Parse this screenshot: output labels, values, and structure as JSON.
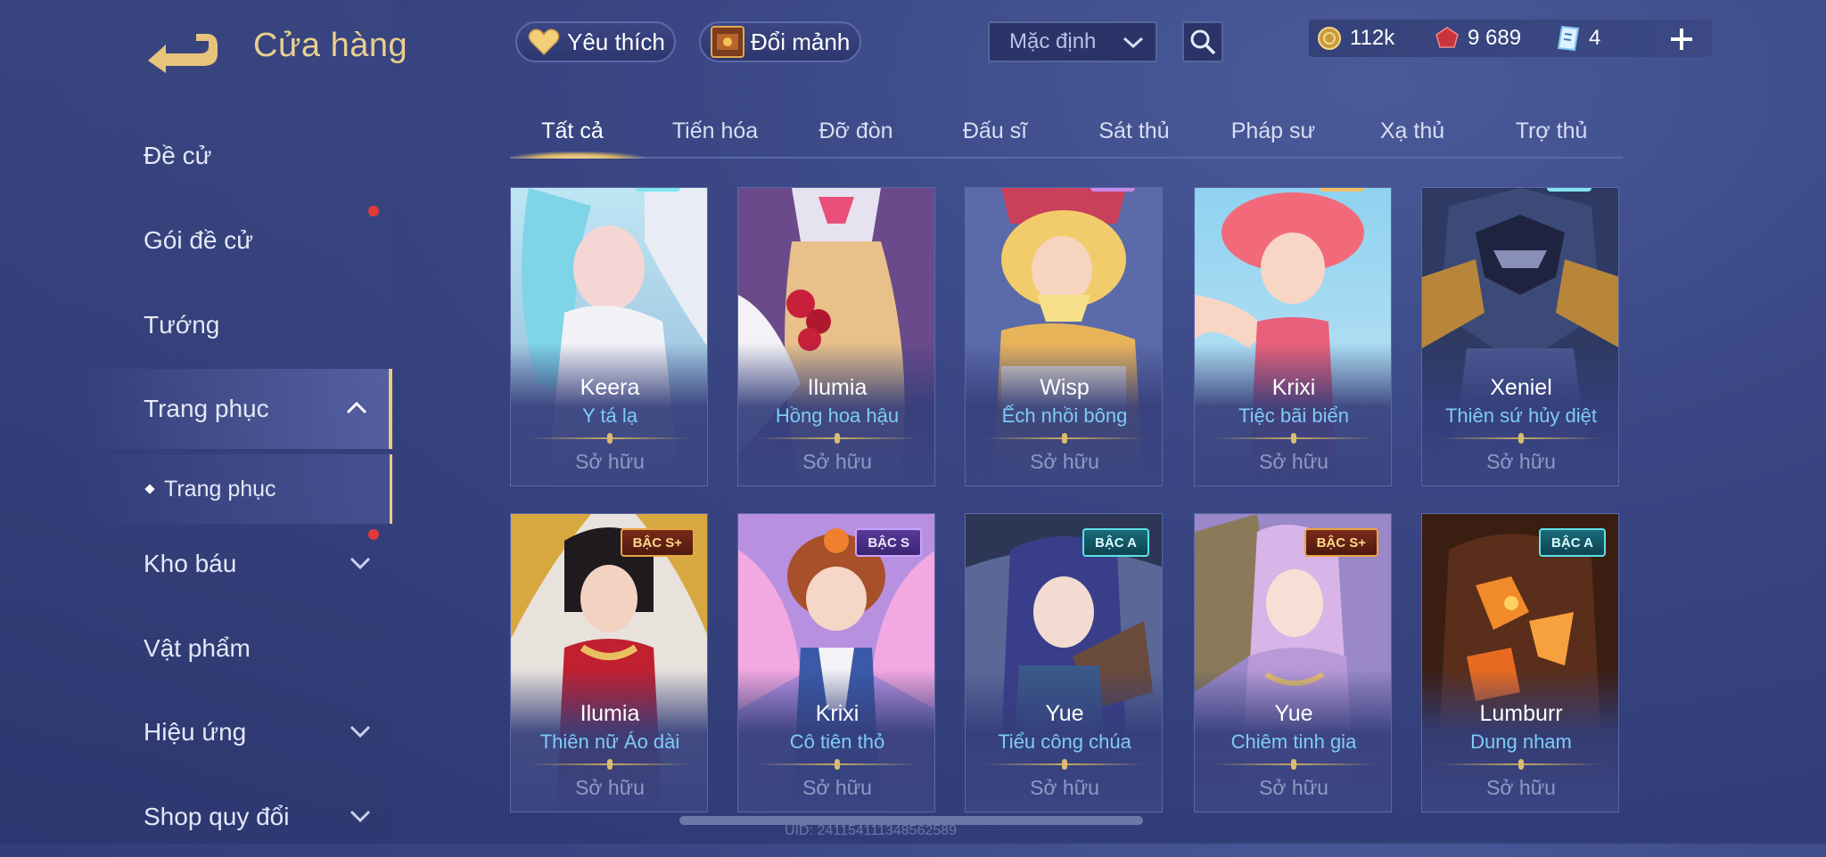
{
  "header": {
    "title": "Cửa hàng",
    "favorite_label": "Yêu thích",
    "exchange_label": "Đổi mảnh",
    "sort_value": "Mặc định"
  },
  "currency": {
    "gold": "112k",
    "ruby": "9 689",
    "voucher": "4"
  },
  "sidebar": {
    "items": [
      {
        "label": "Đề cử"
      },
      {
        "label": "Gói đề cử"
      },
      {
        "label": "Tướng"
      },
      {
        "label": "Trang phục"
      },
      {
        "label": "Kho báu"
      },
      {
        "label": "Vật phẩm"
      },
      {
        "label": "Hiệu ứng"
      },
      {
        "label": "Shop quy đổi"
      }
    ],
    "sub_item": "Trang phục"
  },
  "tabs": [
    "Tất cả",
    "Tiến hóa",
    "Đỡ đòn",
    "Đấu sĩ",
    "Sát thủ",
    "Pháp sư",
    "Xạ thủ",
    "Trợ thủ"
  ],
  "active_tab": "Tất cả",
  "cards": [
    {
      "hero": "Keera",
      "skin": "Y tá lạ",
      "status": "Sở hữu",
      "badge": ""
    },
    {
      "hero": "Ilumia",
      "skin": "Hồng hoa hậu",
      "status": "Sở hữu",
      "badge": ""
    },
    {
      "hero": "Wisp",
      "skin": "Ếch nhồi bông",
      "status": "Sở hữu",
      "badge": ""
    },
    {
      "hero": "Krixi",
      "skin": "Tiệc bãi biển",
      "status": "Sở hữu",
      "badge": ""
    },
    {
      "hero": "Xeniel",
      "skin": "Thiên sứ hủy diệt",
      "status": "Sở hữu",
      "badge": ""
    },
    {
      "hero": "Ilumia",
      "skin": "Thiên nữ Áo dài",
      "status": "Sở hữu",
      "badge": "BẬC S+"
    },
    {
      "hero": "Krixi",
      "skin": "Cô tiên thỏ",
      "status": "Sở hữu",
      "badge": "BẬC S"
    },
    {
      "hero": "Yue",
      "skin": "Tiểu công chúa",
      "status": "Sở hữu",
      "badge": "BẬC A"
    },
    {
      "hero": "Yue",
      "skin": "Chiêm tinh gia",
      "status": "Sở hữu",
      "badge": "BẬC S+"
    },
    {
      "hero": "Lumburr",
      "skin": "Dung nham",
      "status": "Sở hữu",
      "badge": "BẬC A"
    }
  ],
  "footer": {
    "uid": "UID: 241154111348562589"
  },
  "colors": {
    "accent_gold": "#e9cf8f",
    "skin_name_blue": "#7ecbf4",
    "notification_red": "#e23a3a"
  }
}
